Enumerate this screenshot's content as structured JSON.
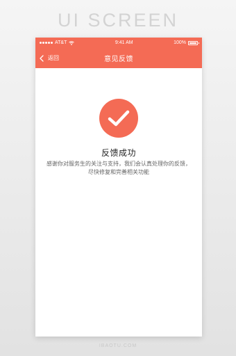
{
  "banner": {
    "title": "UI SCREEN"
  },
  "status_bar": {
    "carrier": "AT&T",
    "time": "9:41 AM",
    "battery": "100%",
    "battery_level": 1.0
  },
  "nav": {
    "back_label": "返回",
    "title": "意见反馈"
  },
  "result": {
    "title": "反馈成功",
    "message": "感谢你对服务生的关注与支持，我们会认真处理你的反馈，尽快修复和完善相关功能"
  },
  "colors": {
    "accent": "#f46b55",
    "background": "#ffffff"
  },
  "icons": [
    "back-chevron-icon",
    "wifi-icon",
    "battery-icon",
    "checkmark-icon"
  ],
  "watermark": "IBAOTU.COM"
}
